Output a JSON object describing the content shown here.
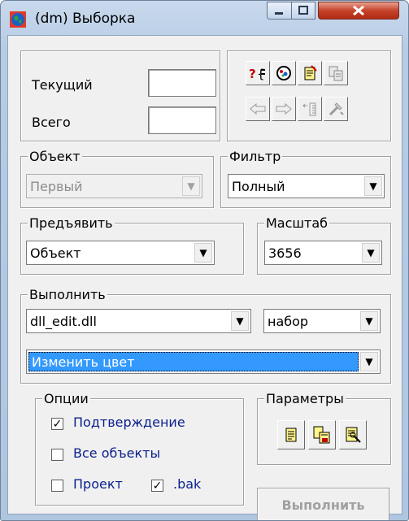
{
  "window": {
    "title": "(dm) Выборка"
  },
  "counters": {
    "current_label": "Текущий",
    "current_value": "",
    "total_label": "Всего",
    "total_value": ""
  },
  "toolbar": {
    "row1": [
      "query-icon",
      "view-icon",
      "edit-doc-icon",
      "copy-doc-icon"
    ],
    "row2": [
      "arrow-left-icon",
      "arrow-right-icon",
      "ruler-icon",
      "tools-icon"
    ]
  },
  "object": {
    "legend": "Объект",
    "value": "Первый"
  },
  "filter": {
    "legend": "Фильтр",
    "value": "Полный"
  },
  "present": {
    "legend": "Предъявить",
    "value": "Объект"
  },
  "scale": {
    "legend": "Масштаб",
    "value": "3656"
  },
  "execute": {
    "legend": "Выполнить",
    "dll_value": "dll_edit.dll",
    "set_value": "набор",
    "action_value": "Изменить цвет"
  },
  "options": {
    "legend": "Опции",
    "confirm_label": "Подтверждение",
    "confirm_checked": true,
    "all_objects_label": "Все объекты",
    "all_objects_checked": false,
    "project_label": "Проект",
    "project_checked": false,
    "bak_label": ".bak",
    "bak_checked": true
  },
  "params": {
    "legend": "Параметры",
    "buttons": [
      "param-doc-icon",
      "param-save-icon",
      "param-settings-icon"
    ]
  },
  "run_button_label": "Выполнить",
  "colors": {
    "selection": "#3399ff",
    "option_text": "#0b1f8c",
    "close_button": "#c5432a"
  }
}
